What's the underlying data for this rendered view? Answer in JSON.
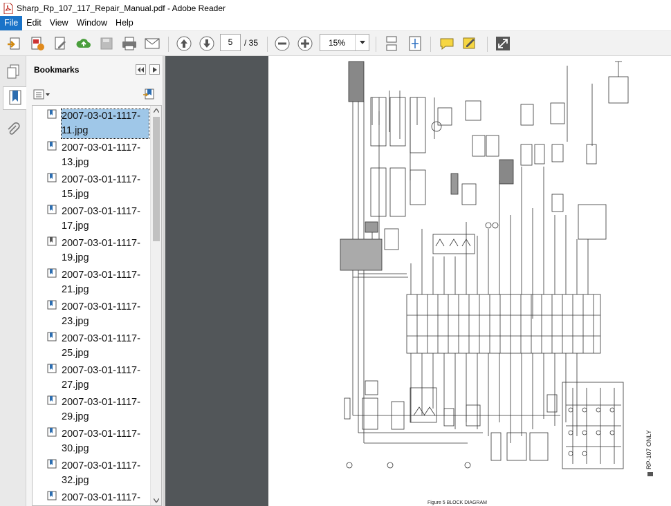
{
  "window": {
    "title": "Sharp_Rp_107_117_Repair_Manual.pdf - Adobe Reader"
  },
  "menu": {
    "items": [
      "File",
      "Edit",
      "View",
      "Window",
      "Help"
    ]
  },
  "toolbar": {
    "icons": [
      "create-pdf-icon",
      "export-pdf-icon",
      "edit-pdf-icon",
      "upload-cloud-icon",
      "save-icon",
      "print-icon",
      "email-icon",
      "previous-page-icon",
      "next-page-icon",
      "zoom-out-icon",
      "zoom-in-icon",
      "scroll-mode-icon",
      "fit-page-icon",
      "comment-icon",
      "sign-icon",
      "fullscreen-icon"
    ],
    "page_current": "5",
    "page_total": "/ 35",
    "zoom": "15%"
  },
  "bookmarks_panel": {
    "title": "Bookmarks",
    "items": [
      {
        "label": "2007-03-01-1117-\n11.jpg",
        "selected": true
      },
      {
        "label": "2007-03-01-1117-\n13.jpg"
      },
      {
        "label": "2007-03-01-1117-\n15.jpg"
      },
      {
        "label": "2007-03-01-1117-\n17.jpg"
      },
      {
        "label": "2007-03-01-1117-\n19.jpg"
      },
      {
        "label": "2007-03-01-1117-\n21.jpg"
      },
      {
        "label": "2007-03-01-1117-\n23.jpg"
      },
      {
        "label": "2007-03-01-1117-\n25.jpg"
      },
      {
        "label": "2007-03-01-1117-\n27.jpg"
      },
      {
        "label": "2007-03-01-1117-\n29.jpg"
      },
      {
        "label": "2007-03-01-1117-\n30.jpg"
      },
      {
        "label": "2007-03-01-1117-\n32.jpg"
      },
      {
        "label": "2007-03-01-1117-"
      }
    ]
  },
  "document": {
    "caption": "Figure 5 BLOCK DIAGRAM",
    "side_note": "RP-107 ONLY"
  },
  "colors": {
    "accent": "#1a73c8",
    "selection": "#9fc7e8",
    "viewer_bg": "#525659"
  }
}
